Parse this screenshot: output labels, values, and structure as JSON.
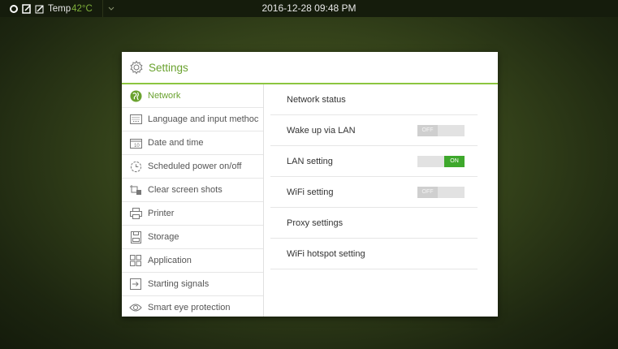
{
  "topbar": {
    "temp_label": "Temp",
    "temp_value": "42°C",
    "datetime": "2016-12-28 09:48 PM"
  },
  "dialog": {
    "title": "Settings"
  },
  "sidebar": {
    "items": [
      {
        "label": "Network",
        "icon": "globe-icon",
        "active": true
      },
      {
        "label": "Language and input methoc",
        "icon": "keyboard-icon"
      },
      {
        "label": "Date and time",
        "icon": "calendar-icon"
      },
      {
        "label": "Scheduled power on/off",
        "icon": "clock-icon"
      },
      {
        "label": "Clear screen shots",
        "icon": "clear-screenshot-icon"
      },
      {
        "label": "Printer",
        "icon": "printer-icon"
      },
      {
        "label": "Storage",
        "icon": "storage-icon"
      },
      {
        "label": "Application",
        "icon": "grid-icon"
      },
      {
        "label": "Starting signals",
        "icon": "signal-input-icon"
      },
      {
        "label": "Smart eye protection",
        "icon": "eye-icon"
      }
    ]
  },
  "content": {
    "rows": [
      {
        "label": "Network status"
      },
      {
        "label": "Wake up via LAN",
        "toggle": "OFF"
      },
      {
        "label": "LAN setting",
        "toggle": "ON"
      },
      {
        "label": "WiFi setting",
        "toggle": "OFF"
      },
      {
        "label": "Proxy settings"
      },
      {
        "label": "WiFi hotspot setting"
      }
    ]
  },
  "colors": {
    "accent": "#8cc63f",
    "toggle_on": "#3ea82c"
  }
}
